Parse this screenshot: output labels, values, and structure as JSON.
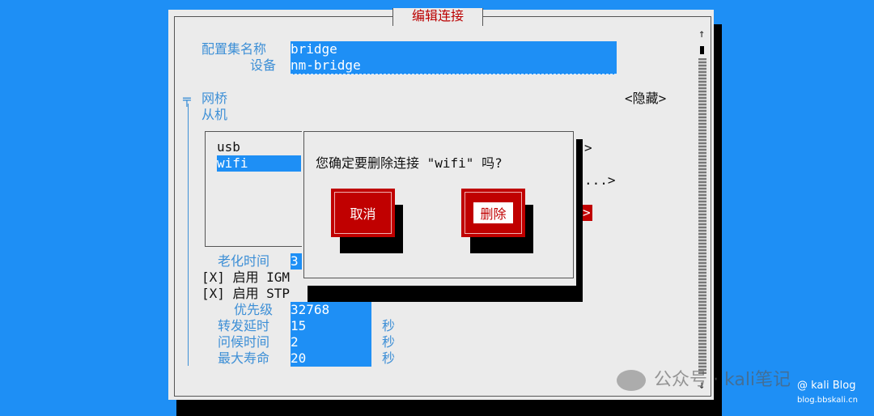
{
  "window": {
    "title": "编辑连接"
  },
  "form": {
    "profile_name_label": "配置集名称",
    "profile_name_value": "bridge",
    "device_label": "设备",
    "device_value": "nm-bridge",
    "bridge_label": "网桥",
    "hide_button": "<隐藏>",
    "slaves_label": "从机",
    "slaves": [
      "usb",
      "wifi"
    ],
    "aging_label": "老化时间",
    "aging_value": "3",
    "igmp_checkbox": "[X] 启用 IGM",
    "stp_checkbox": "[X] 启用 STP",
    "priority_label": "优先级",
    "priority_value": "32768",
    "forward_delay_label": "转发延时",
    "forward_delay_value": "15",
    "hello_time_label": "问候时间",
    "hello_time_value": "2",
    "max_age_label": "最大寿命",
    "max_age_value": "20",
    "seconds_unit": "秒",
    "partial_right": [
      ">",
      "...>",
      ">"
    ]
  },
  "dialog": {
    "message": "您确定要删除连接 \"wifi\" 吗?",
    "cancel_button": "取消",
    "delete_button": "删除"
  },
  "scrollbar": {
    "up": "↑",
    "down": "↓"
  },
  "watermark": {
    "line1": "公众号 · kali笔记",
    "line2": "@ kali Blog",
    "line3": "blog.bbskali.cn"
  },
  "colors": {
    "background": "#1e8ff5",
    "accent_red": "#c00000",
    "field": "#1e8ff5"
  }
}
